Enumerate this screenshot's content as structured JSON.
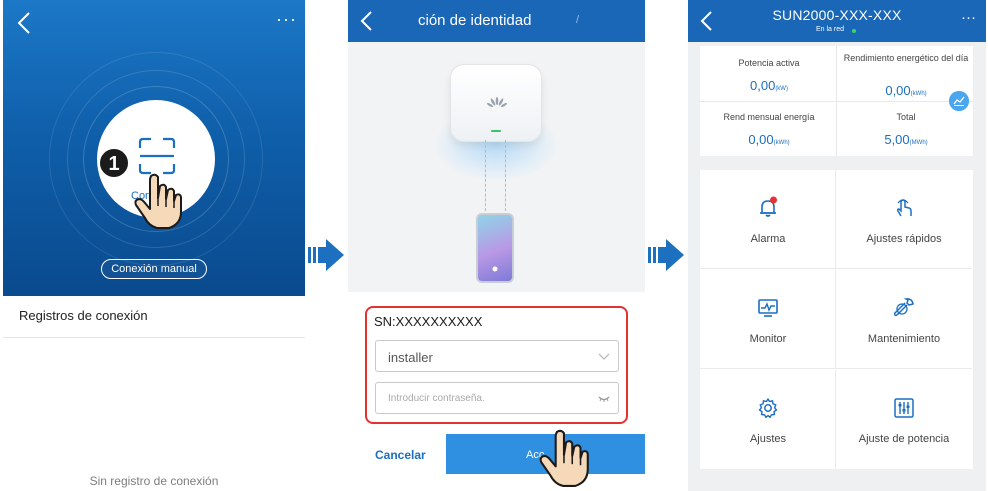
{
  "panel1": {
    "scan_label": "Con",
    "step_number": "1",
    "manual_button": "Conexión manual",
    "records_header": "Registros de conexión",
    "empty_text": "Sin registro de conexión"
  },
  "panel2": {
    "title": "ción de identidad",
    "sn": "SN:XXXXXXXXXX",
    "username": "installer",
    "password_placeholder": "Introducir contraseña.",
    "cancel": "Cancelar",
    "accept": "Acc"
  },
  "panel3": {
    "title": "SUN2000-XXX-XXX",
    "status": "En la red",
    "stats": [
      {
        "label": "Potencia activa",
        "value": "0,00",
        "unit": "(kW)"
      },
      {
        "label": "Rendimiento energético del día",
        "value": "0,00",
        "unit": "(kWh)"
      },
      {
        "label": "Rend mensual energía",
        "value": "0,00",
        "unit": "(kWh)"
      },
      {
        "label": "Total",
        "value": "5,00",
        "unit": "(MWh)"
      }
    ],
    "tiles": [
      {
        "label": "Alarma",
        "icon": "alarm-bell-icon"
      },
      {
        "label": "Ajustes rápidos",
        "icon": "quick-settings-hand-icon"
      },
      {
        "label": "Monitor",
        "icon": "monitor-icon"
      },
      {
        "label": "Mantenimiento",
        "icon": "wrench-icon"
      },
      {
        "label": "Ajustes",
        "icon": "gear-icon"
      },
      {
        "label": "Ajuste de potencia",
        "icon": "sliders-icon"
      }
    ]
  },
  "colors": {
    "brand_blue": "#1a67b8",
    "accent_blue": "#1b6ec2",
    "highlight_red": "#e23232",
    "online_green": "#3cd56b"
  }
}
